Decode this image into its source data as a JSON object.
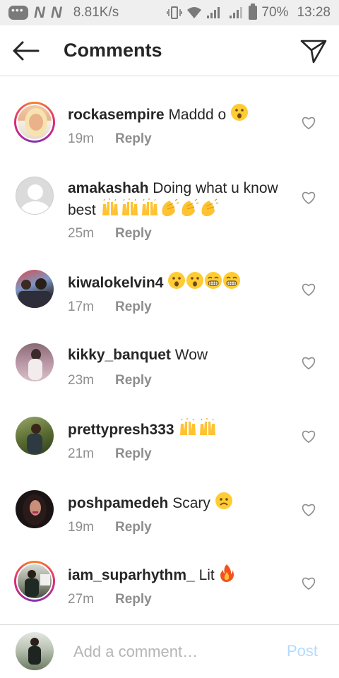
{
  "status_bar": {
    "network_speed": "8.81K/s",
    "battery_percent": "70%",
    "time": "13:28",
    "carrier_letters": [
      "N",
      "N"
    ]
  },
  "header": {
    "title": "Comments"
  },
  "comments": [
    {
      "username": "rockasempire",
      "text": "Maddd o",
      "emojis": [
        "hushed"
      ],
      "time": "19m",
      "reply": "Reply",
      "story_ring": true
    },
    {
      "username": "amakashah",
      "text": "Doing what u know best",
      "emojis": [
        "raised-hands",
        "raised-hands",
        "raised-hands",
        "clap",
        "clap",
        "clap"
      ],
      "time": "25m",
      "reply": "Reply",
      "story_ring": false
    },
    {
      "username": "kiwalokelvin4",
      "text": "",
      "emojis": [
        "hushed",
        "hushed",
        "grin",
        "grin"
      ],
      "time": "17m",
      "reply": "Reply",
      "story_ring": false
    },
    {
      "username": "kikky_banquet",
      "text": "Wow",
      "emojis": [],
      "time": "23m",
      "reply": "Reply",
      "story_ring": false
    },
    {
      "username": "prettypresh333",
      "text": "",
      "emojis": [
        "raised-hands",
        "raised-hands"
      ],
      "time": "21m",
      "reply": "Reply",
      "story_ring": false
    },
    {
      "username": "poshpamedeh",
      "text": "Scary",
      "emojis": [
        "frowning"
      ],
      "time": "19m",
      "reply": "Reply",
      "story_ring": false
    },
    {
      "username": "iam_suparhythm_",
      "text": "Lit",
      "emojis": [
        "fire"
      ],
      "time": "27m",
      "reply": "Reply",
      "story_ring": true
    }
  ],
  "composer": {
    "placeholder": "Add a comment…",
    "post_label": "Post"
  },
  "colors": {
    "accent_post_disabled": "#b3dbff",
    "muted_text": "#8e8e8e",
    "divider": "#dbdbdb",
    "status_bar_bg": "#efefef"
  }
}
